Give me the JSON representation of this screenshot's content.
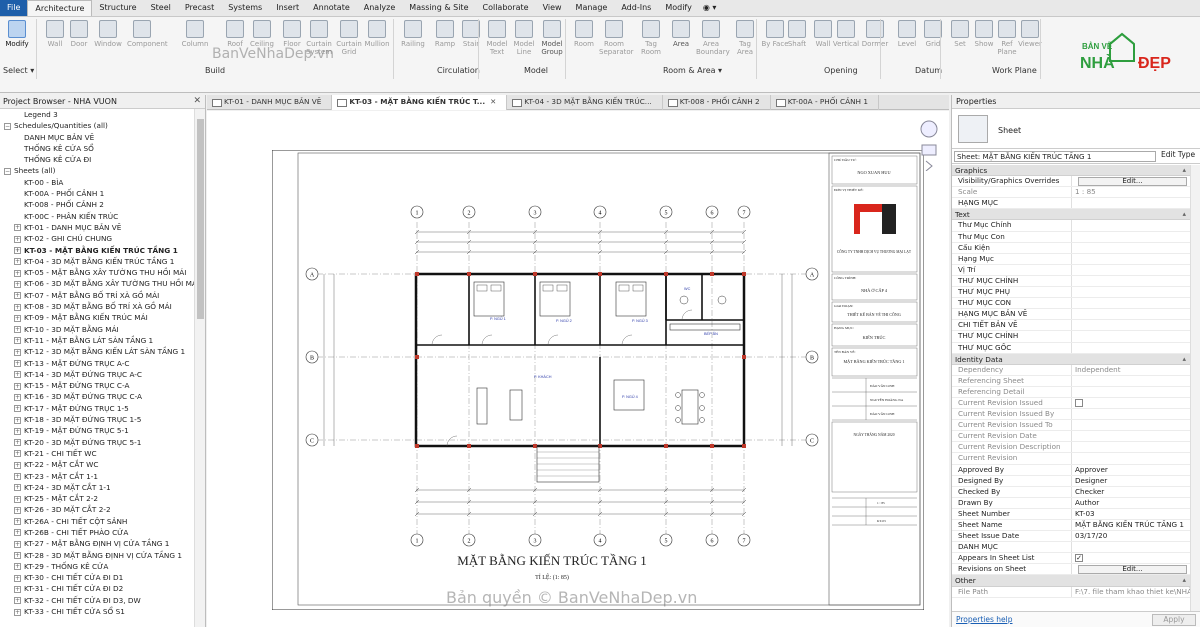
{
  "ribbon": {
    "tabs": [
      "File",
      "Architecture",
      "Structure",
      "Steel",
      "Precast",
      "Systems",
      "Insert",
      "Annotate",
      "Analyze",
      "Massing & Site",
      "Collaborate",
      "View",
      "Manage",
      "Add-Ins",
      "Modify",
      "◉ ▾"
    ],
    "active_tab": "Architecture",
    "buttons": [
      {
        "label": "Modify",
        "state": "selected"
      },
      {
        "label": "Wall",
        "state": "dim"
      },
      {
        "label": "Door",
        "state": "dim"
      },
      {
        "label": "Window",
        "state": "dim"
      },
      {
        "label": "Component",
        "state": "dim"
      },
      {
        "label": "Column",
        "state": "dim"
      },
      {
        "label": "Roof",
        "state": "dim"
      },
      {
        "label": "Ceiling",
        "state": "dim"
      },
      {
        "label": "Floor",
        "state": "dim"
      },
      {
        "label": "Curtain System",
        "state": "dim"
      },
      {
        "label": "Curtain Grid",
        "state": "dim"
      },
      {
        "label": "Mullion",
        "state": "dim"
      },
      {
        "label": "Railing",
        "state": "dim"
      },
      {
        "label": "Ramp",
        "state": "dim"
      },
      {
        "label": "Stair",
        "state": "dim"
      },
      {
        "label": "Model Text",
        "state": "dim"
      },
      {
        "label": "Model Line",
        "state": "dim"
      },
      {
        "label": "Model Group",
        "state": "normal"
      },
      {
        "label": "Room",
        "state": "dim"
      },
      {
        "label": "Room Separator",
        "state": "dim"
      },
      {
        "label": "Tag Room",
        "state": "dim"
      },
      {
        "label": "Area",
        "state": "normal"
      },
      {
        "label": "Area Boundary",
        "state": "dim"
      },
      {
        "label": "Tag Area",
        "state": "dim"
      },
      {
        "label": "By Face",
        "state": "dim"
      },
      {
        "label": "Shaft",
        "state": "dim"
      },
      {
        "label": "Wall",
        "state": "dim"
      },
      {
        "label": "Vertical",
        "state": "dim"
      },
      {
        "label": "Dormer",
        "state": "dim"
      },
      {
        "label": "Level",
        "state": "dim"
      },
      {
        "label": "Grid",
        "state": "dim"
      },
      {
        "label": "Set",
        "state": "dim"
      },
      {
        "label": "Show",
        "state": "dim"
      },
      {
        "label": "Ref Plane",
        "state": "dim"
      },
      {
        "label": "Viewer",
        "state": "dim"
      }
    ],
    "groups": [
      "Select ▾",
      "Build",
      "Circulation",
      "Model",
      "Room & Area ▾",
      "Opening",
      "Datum",
      "Work Plane"
    ]
  },
  "brand": {
    "line1": "BẢN VẼ",
    "line2_a": "NHÀ",
    "line2_b": "ĐẸP",
    "accent": "#2e9e3e",
    "red": "#d9261c"
  },
  "project_browser": {
    "title": "Project Browser - NHA VUON",
    "items": [
      {
        "text": "Legend 3",
        "indent": 2,
        "mark": ""
      },
      {
        "text": "Schedules/Quantities (all)",
        "indent": 0,
        "mark": "−"
      },
      {
        "text": "DANH MỤC BẢN VẼ",
        "indent": 2,
        "mark": ""
      },
      {
        "text": "THỐNG KÊ CỬA SỔ",
        "indent": 2,
        "mark": ""
      },
      {
        "text": "THỐNG KÊ CỬA ĐI",
        "indent": 2,
        "mark": ""
      },
      {
        "text": "Sheets (all)",
        "indent": 0,
        "mark": "−"
      },
      {
        "text": "KT-00 - BÌA",
        "indent": 2,
        "mark": ""
      },
      {
        "text": "KT-00A - PHỐI CẢNH 1",
        "indent": 2,
        "mark": ""
      },
      {
        "text": "KT-008 - PHỐI CẢNH 2",
        "indent": 2,
        "mark": ""
      },
      {
        "text": "KT-00C - PHÂN KIẾN TRÚC",
        "indent": 2,
        "mark": ""
      },
      {
        "text": "KT-01 - DANH MỤC BẢN VẼ",
        "indent": 1,
        "mark": "+"
      },
      {
        "text": "KT-02 - GHI CHÚ CHUNG",
        "indent": 1,
        "mark": "+"
      },
      {
        "text": "KT-03 - MẶT BẰNG KIẾN TRÚC TẦNG 1",
        "indent": 1,
        "mark": "+",
        "selected": true
      },
      {
        "text": "KT-04 - 3D MẶT BẰNG KIẾN TRÚC TẦNG 1",
        "indent": 1,
        "mark": "+"
      },
      {
        "text": "KT-05 - MẶT BẰNG XÂY TƯỜNG THU HỒI MÁI",
        "indent": 1,
        "mark": "+"
      },
      {
        "text": "KT-06 - 3D MẶT BẰNG XÂY TƯỜNG THU HỒI MÁI",
        "indent": 1,
        "mark": "+"
      },
      {
        "text": "KT-07 - MẶT BẰNG BỐ TRÍ XÀ GỒ MÁI",
        "indent": 1,
        "mark": "+"
      },
      {
        "text": "KT-08 - 3D MẶT BẰNG BỐ TRÍ XÀ GỒ MÁI",
        "indent": 1,
        "mark": "+"
      },
      {
        "text": "KT-09 - MẶT BẰNG KIẾN TRÚC MÁI",
        "indent": 1,
        "mark": "+"
      },
      {
        "text": "KT-10 - 3D MẶT BẰNG MÁI",
        "indent": 1,
        "mark": "+"
      },
      {
        "text": "KT-11 - MẶT BẰNG LÁT SÀN TẦNG 1",
        "indent": 1,
        "mark": "+"
      },
      {
        "text": "KT-12 - 3D MẶT BẰNG KIẾN LÁT SÀN TẦNG 1",
        "indent": 1,
        "mark": "+"
      },
      {
        "text": "KT-13 - MẶT ĐỨNG TRỤC A-C",
        "indent": 1,
        "mark": "+"
      },
      {
        "text": "KT-14 - 3D MẶT ĐỨNG TRỤC A-C",
        "indent": 1,
        "mark": "+"
      },
      {
        "text": "KT-15 - MẶT ĐỨNG TRỤC C-A",
        "indent": 1,
        "mark": "+"
      },
      {
        "text": "KT-16 - 3D MẶT ĐỨNG TRỤC C-A",
        "indent": 1,
        "mark": "+"
      },
      {
        "text": "KT-17 - MẶT ĐỨNG TRỤC 1-5",
        "indent": 1,
        "mark": "+"
      },
      {
        "text": "KT-18 - 3D MẶT ĐỨNG TRỤC 1-5",
        "indent": 1,
        "mark": "+"
      },
      {
        "text": "KT-19 - MẶT ĐỨNG TRỤC 5-1",
        "indent": 1,
        "mark": "+"
      },
      {
        "text": "KT-20 - 3D MẶT ĐỨNG TRỤC 5-1",
        "indent": 1,
        "mark": "+"
      },
      {
        "text": "KT-21 - CHI TIẾT WC",
        "indent": 1,
        "mark": "+"
      },
      {
        "text": "KT-22 - MẶT CẮT WC",
        "indent": 1,
        "mark": "+"
      },
      {
        "text": "KT-23 - MẶT CẮT 1-1",
        "indent": 1,
        "mark": "+"
      },
      {
        "text": "KT-24 - 3D MẶT CẮT 1-1",
        "indent": 1,
        "mark": "+"
      },
      {
        "text": "KT-25 - MẶT CẮT 2-2",
        "indent": 1,
        "mark": "+"
      },
      {
        "text": "KT-26 - 3D MẶT CẮT 2-2",
        "indent": 1,
        "mark": "+"
      },
      {
        "text": "KT-26A - CHI TIẾT CỘT SẢNH",
        "indent": 1,
        "mark": "+"
      },
      {
        "text": "KT-26B - CHI TIẾT PHÀO CỬA",
        "indent": 1,
        "mark": "+"
      },
      {
        "text": "KT-27 - MẶT BẰNG ĐỊNH VỊ CỬA TẦNG 1",
        "indent": 1,
        "mark": "+"
      },
      {
        "text": "KT-28 - 3D MẶT BẰNG ĐỊNH VỊ CỬA TẦNG 1",
        "indent": 1,
        "mark": "+"
      },
      {
        "text": "KT-29 - THỐNG KÊ CỬA",
        "indent": 1,
        "mark": "+"
      },
      {
        "text": "KT-30 - CHI TIẾT CỬA ĐI D1",
        "indent": 1,
        "mark": "+"
      },
      {
        "text": "KT-31 - CHI TIẾT CỬA ĐI D2",
        "indent": 1,
        "mark": "+"
      },
      {
        "text": "KT-32 - CHI TIẾT CỬA ĐI D3, DW",
        "indent": 1,
        "mark": "+"
      },
      {
        "text": "KT-33 - CHI TIẾT CỬA SỔ S1",
        "indent": 1,
        "mark": "+"
      }
    ]
  },
  "view_tabs": [
    {
      "label": "KT-01 - DANH MỤC BẢN VẼ",
      "active": false
    },
    {
      "label": "KT-03 - MẶT BẰNG KIẾN TRÚC T...",
      "active": true
    },
    {
      "label": "KT-04 - 3D MẶT BẰNG KIẾN TRÚC...",
      "active": false
    },
    {
      "label": "KT-008 - PHỐI CẢNH 2",
      "active": false
    },
    {
      "label": "KT-00A - PHỐI CẢNH 1",
      "active": false
    }
  ],
  "drawing": {
    "title": "MẶT BẰNG KIẾN TRÚC TẦNG 1",
    "scale": "TỈ LỆ: (1: 85)",
    "grid_cols": [
      "1",
      "2",
      "3",
      "4",
      "5",
      "6",
      "7"
    ],
    "grid_rows": [
      "A",
      "B",
      "C"
    ],
    "rooms": [
      "P. NGỦ 1",
      "P. NGỦ 2",
      "P. NGỦ 3",
      "P. KHÁCH",
      "P. NGỦ 4",
      "WC",
      "BẾP ĂN"
    ],
    "title_block": {
      "label1": "CHỦ ĐẦU TƯ:",
      "owner": "NGO XUAN HUU",
      "label2": "ĐƠN VỊ THIẾT KẾ:",
      "company": "CÔNG TY TNHH DỊCH VỤ THƯƠNG MẠI LẠT",
      "label3": "CÔNG TRÌNH:",
      "project": "NHÀ Ở CẤP 4",
      "label4": "GIAI ĐOẠN:",
      "phase": "THIẾT KẾ BẢN VẼ THI CÔNG",
      "label5": "HẠNG MỤC:",
      "category": "KIẾN TRÚC",
      "label6": "TÊN BẢN VẼ:",
      "sheet_name": "MẶT BẰNG KIẾN TRÚC TẦNG 1",
      "sig1": "ĐÀO VĂN LINH",
      "sig2": "NGUYỄN HOÀNG NA",
      "sig3": "ĐÀO VĂN LINH",
      "date": "NGÀY   THÁNG   NĂM 2020",
      "scale_val": "1 : 85",
      "sheet_no": "KT-03"
    }
  },
  "properties": {
    "title": "Properties",
    "type_name": "Sheet",
    "selector": "Sheet: MẶT BẰNG KIẾN TRÚC TẦNG 1",
    "edit_type": "Edit Type",
    "sections": [
      {
        "name": "Graphics",
        "rows": [
          {
            "k": "Visibility/Graphics Overrides",
            "v": "Edit...",
            "kind": "button"
          },
          {
            "k": "Scale",
            "v": "1 : 85",
            "kind": "ro"
          },
          {
            "k": "HẠNG MỤC",
            "v": ""
          }
        ]
      },
      {
        "name": "Text",
        "rows": [
          {
            "k": "Thư Mục Chính",
            "v": ""
          },
          {
            "k": "Thư Mục Con",
            "v": ""
          },
          {
            "k": "Cấu Kiện",
            "v": ""
          },
          {
            "k": "Hạng Mục",
            "v": ""
          },
          {
            "k": "Vị Trí",
            "v": ""
          },
          {
            "k": "THƯ MỤC CHÍNH",
            "v": ""
          },
          {
            "k": "THƯ MỤC PHỤ",
            "v": ""
          },
          {
            "k": "THƯ MỤC CON",
            "v": ""
          },
          {
            "k": "HẠNG MỤC BẢN VẼ",
            "v": ""
          },
          {
            "k": "CHI TIẾT BẢN VẼ",
            "v": ""
          },
          {
            "k": "THƯ MỤC CHÍNH",
            "v": ""
          },
          {
            "k": "THƯ MỤC GỐC",
            "v": ""
          }
        ]
      },
      {
        "name": "Identity Data",
        "rows": [
          {
            "k": "Dependency",
            "v": "Independent",
            "kind": "ro"
          },
          {
            "k": "Referencing Sheet",
            "v": "",
            "kind": "ro"
          },
          {
            "k": "Referencing Detail",
            "v": "",
            "kind": "ro"
          },
          {
            "k": "Current Revision Issued",
            "v": "",
            "kind": "ro-check"
          },
          {
            "k": "Current Revision Issued By",
            "v": "",
            "kind": "ro"
          },
          {
            "k": "Current Revision Issued To",
            "v": "",
            "kind": "ro"
          },
          {
            "k": "Current Revision Date",
            "v": "",
            "kind": "ro"
          },
          {
            "k": "Current Revision Description",
            "v": "",
            "kind": "ro"
          },
          {
            "k": "Current Revision",
            "v": "",
            "kind": "ro"
          },
          {
            "k": "Approved By",
            "v": "Approver"
          },
          {
            "k": "Designed By",
            "v": "Designer"
          },
          {
            "k": "Checked By",
            "v": "Checker"
          },
          {
            "k": "Drawn By",
            "v": "Author"
          },
          {
            "k": "Sheet Number",
            "v": "KT-03"
          },
          {
            "k": "Sheet Name",
            "v": "MẶT BẰNG KIẾN TRÚC TẦNG 1"
          },
          {
            "k": "Sheet Issue Date",
            "v": "03/17/20"
          },
          {
            "k": "DANH MỤC",
            "v": ""
          },
          {
            "k": "Appears In Sheet List",
            "v": "✓",
            "kind": "check"
          },
          {
            "k": "Revisions on Sheet",
            "v": "Edit...",
            "kind": "button"
          }
        ]
      },
      {
        "name": "Other",
        "rows": [
          {
            "k": "File Path",
            "v": "F:\\7. file tham khao thiet ke\\NHÀ...",
            "kind": "ro"
          }
        ]
      }
    ],
    "help_link": "Properties help",
    "apply": "Apply"
  },
  "watermarks": [
    "BanVeNhaDep.vn",
    "Bản quyền © BanVeNhaDep.vn"
  ]
}
